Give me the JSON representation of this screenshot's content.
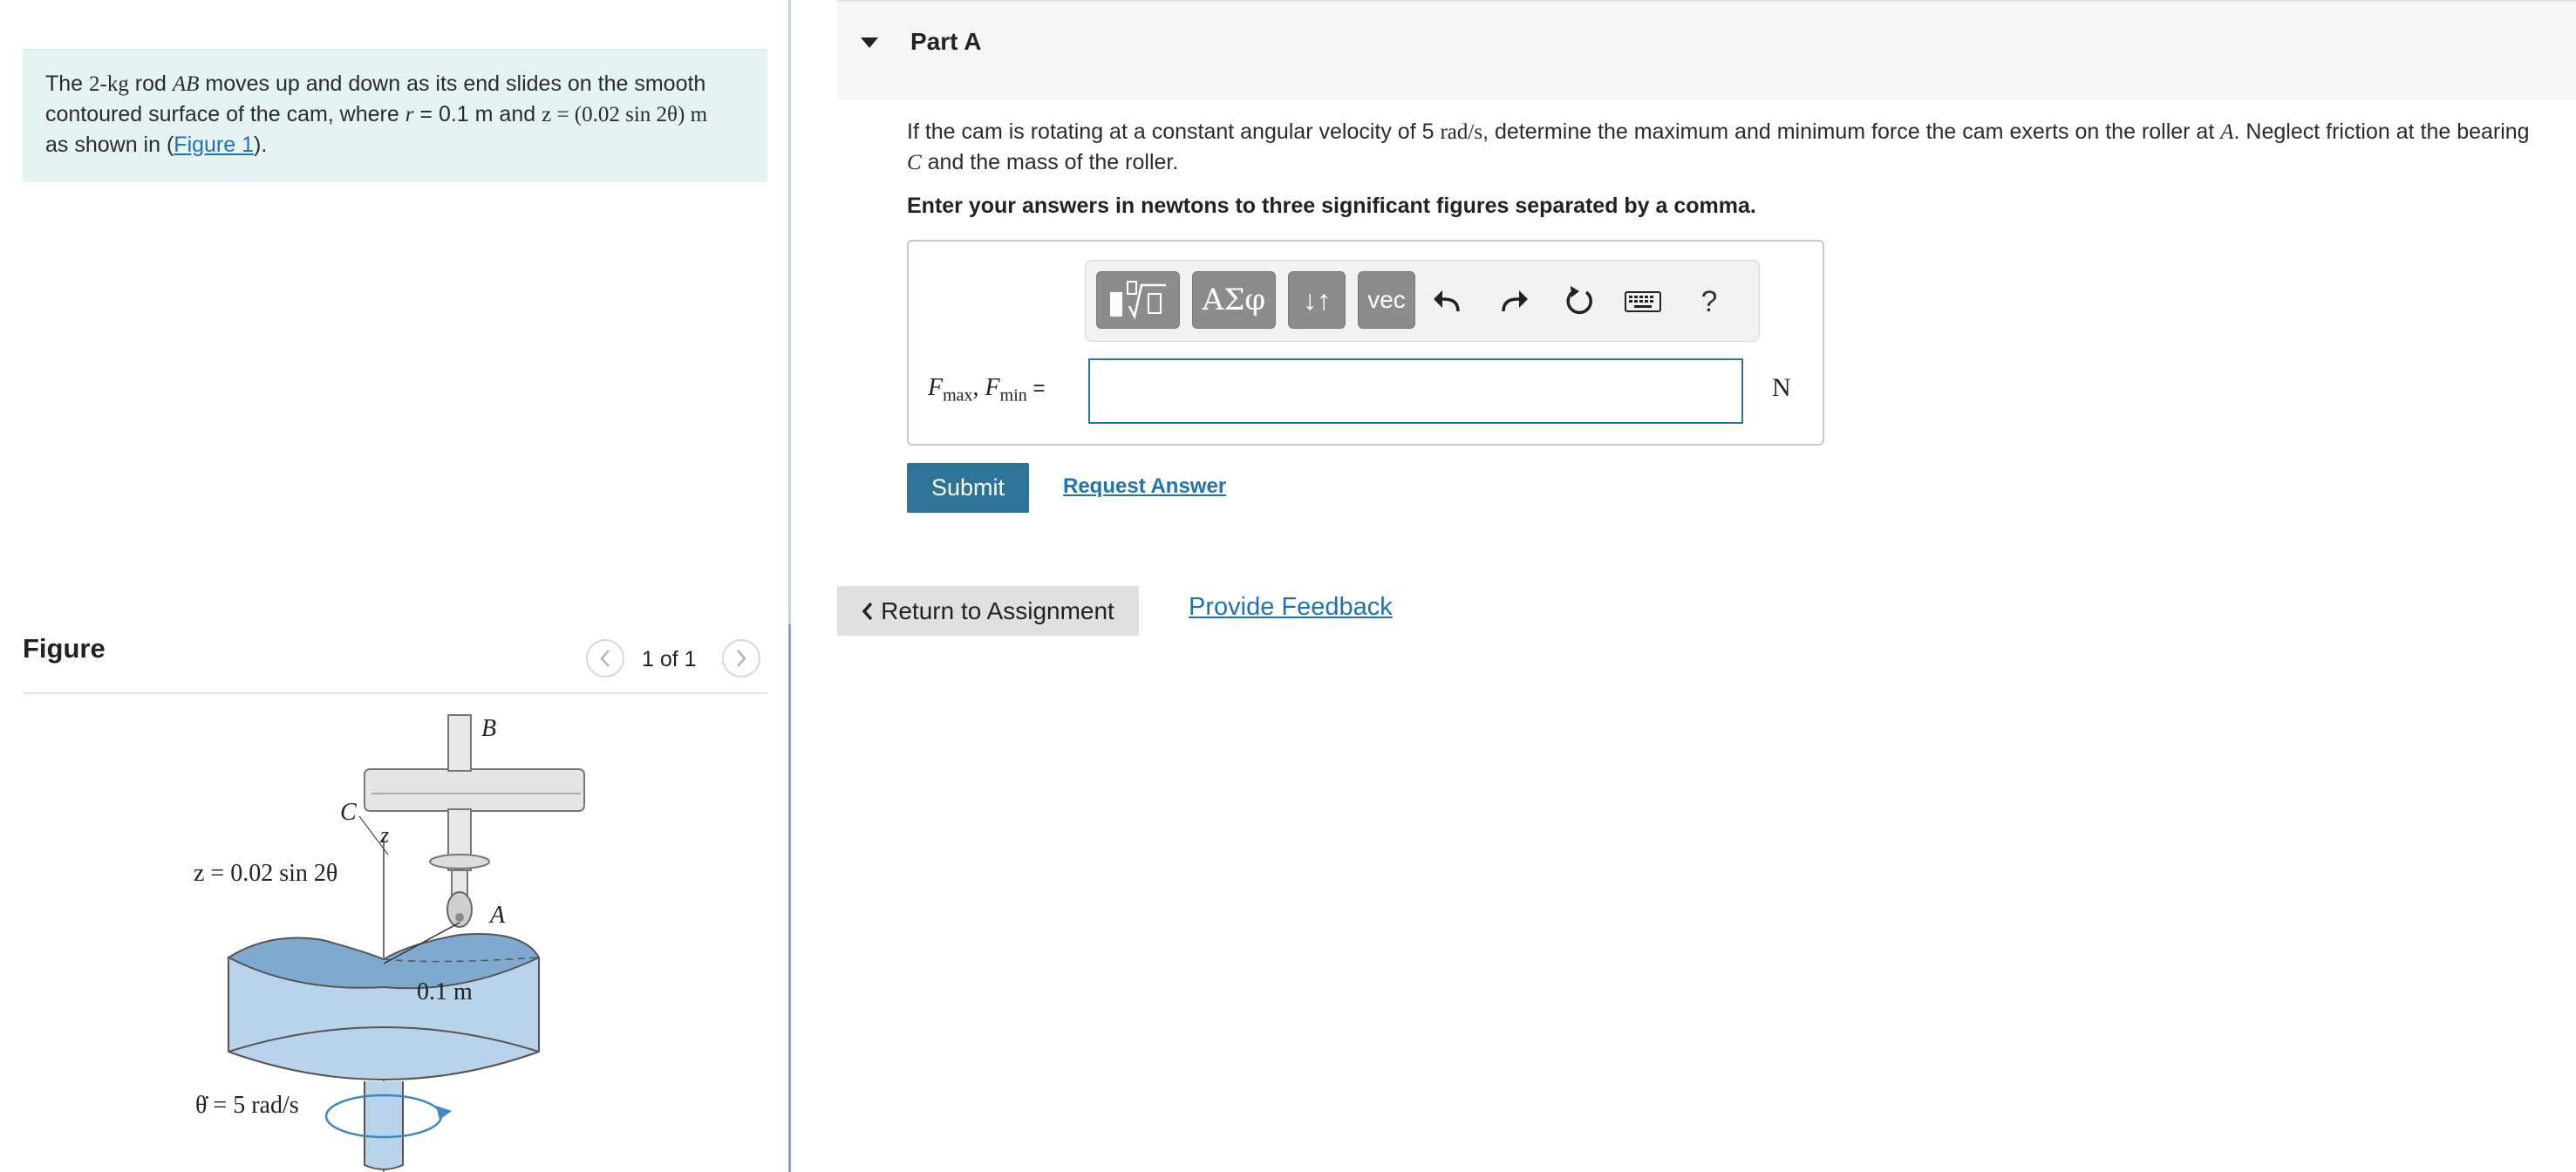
{
  "problem": {
    "text_a": "The ",
    "mass": "2-kg",
    "text_b": " rod ",
    "rod": "AB",
    "text_c": " moves up and down as its end slides on the smooth contoured surface of the cam, where ",
    "r_symbol": "r",
    "r_value": " = 0.1 m",
    "text_d": " and ",
    "z_equation": "z = (0.02 sin 2θ) m",
    "text_e": " as shown in (",
    "figure_link": "Figure 1",
    "text_f": ")."
  },
  "figure_panel": {
    "heading": "Figure",
    "counter": "1 of 1",
    "labels": {
      "B": "B",
      "C": "C",
      "z_axis": "z",
      "z_eq": "z = 0.02 sin 2θ",
      "A": "A",
      "radius": "0.1 m",
      "theta_dot": "θ̇ = 5 rad/s"
    }
  },
  "part": {
    "title": "Part A",
    "question_a": "If the cam is rotating at a constant angular velocity of 5 ",
    "omega_unit": "rad/s",
    "question_b": ", determine the maximum and minimum force the cam exerts on the roller at ",
    "point_A": "A",
    "question_c": ". Neglect friction at the bearing ",
    "point_C": "C",
    "question_d": " and the mass of the roller.",
    "instructions": "Enter your answers in newtons to three significant figures separated by a comma."
  },
  "toolbar": {
    "greek": "ΑΣφ",
    "arrows": "↓↑",
    "vec": "vec",
    "help": "?"
  },
  "answer": {
    "label_F": "F",
    "label_max": "max",
    "label_sep": ", ",
    "label_min": "min",
    "label_eq": " =",
    "value": "",
    "unit": "N"
  },
  "actions": {
    "submit": "Submit",
    "request_answer": "Request Answer",
    "return": "Return to Assignment",
    "feedback": "Provide Feedback"
  },
  "colors": {
    "problem_bg": "#e5f4f3",
    "link": "#1f73b0",
    "submit_bg": "#2d7398",
    "input_border": "#2b73a6",
    "cam_blue": "#a9c8e2"
  }
}
